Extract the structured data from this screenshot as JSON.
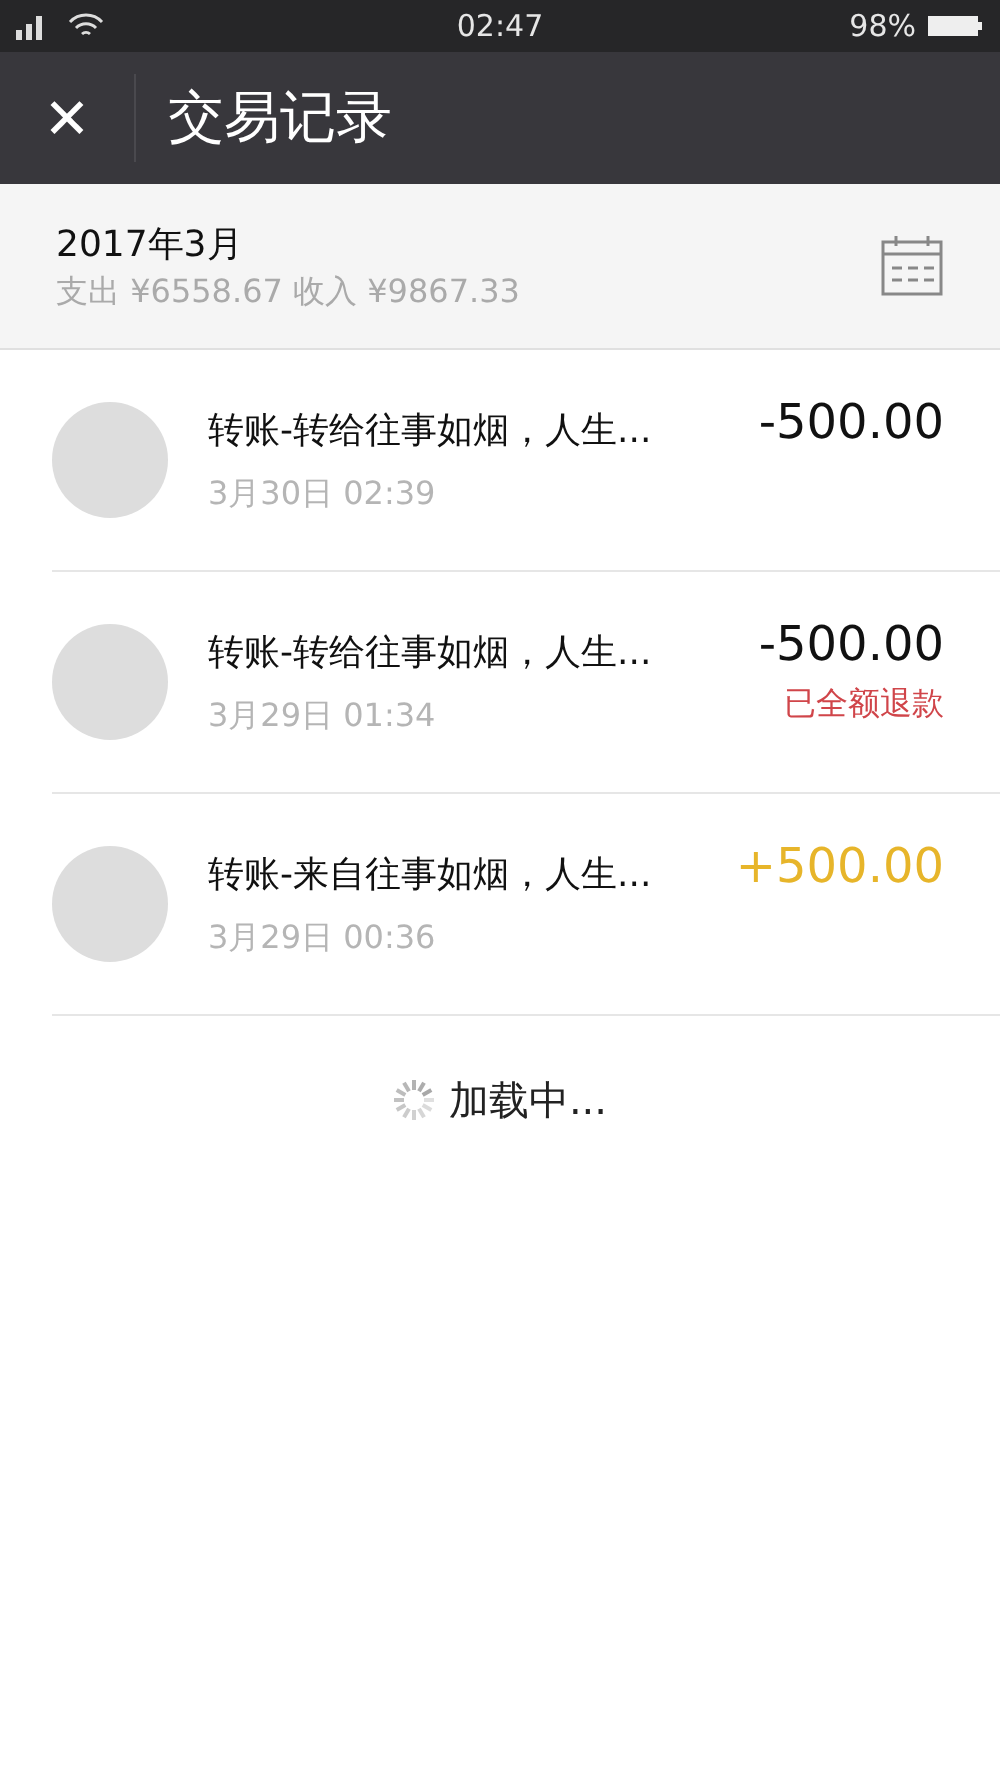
{
  "status_bar": {
    "time": "02:47",
    "battery": "98%"
  },
  "header": {
    "title": "交易记录",
    "close": "✕"
  },
  "summary": {
    "month": "2017年3月",
    "totals": "支出 ¥6558.67 收入 ¥9867.33"
  },
  "transactions": [
    {
      "title": "转账-转给往事如烟，人生...",
      "time": "3月30日 02:39",
      "amount": "-500.00",
      "kind": "expense"
    },
    {
      "title": "转账-转给往事如烟，人生...",
      "time": "3月29日 01:34",
      "amount": "-500.00",
      "kind": "expense",
      "note": "已全额退款"
    },
    {
      "title": "转账-来自往事如烟，人生...",
      "time": "3月29日 00:36",
      "amount": "+500.00",
      "kind": "income"
    }
  ],
  "loading": "加载中..."
}
